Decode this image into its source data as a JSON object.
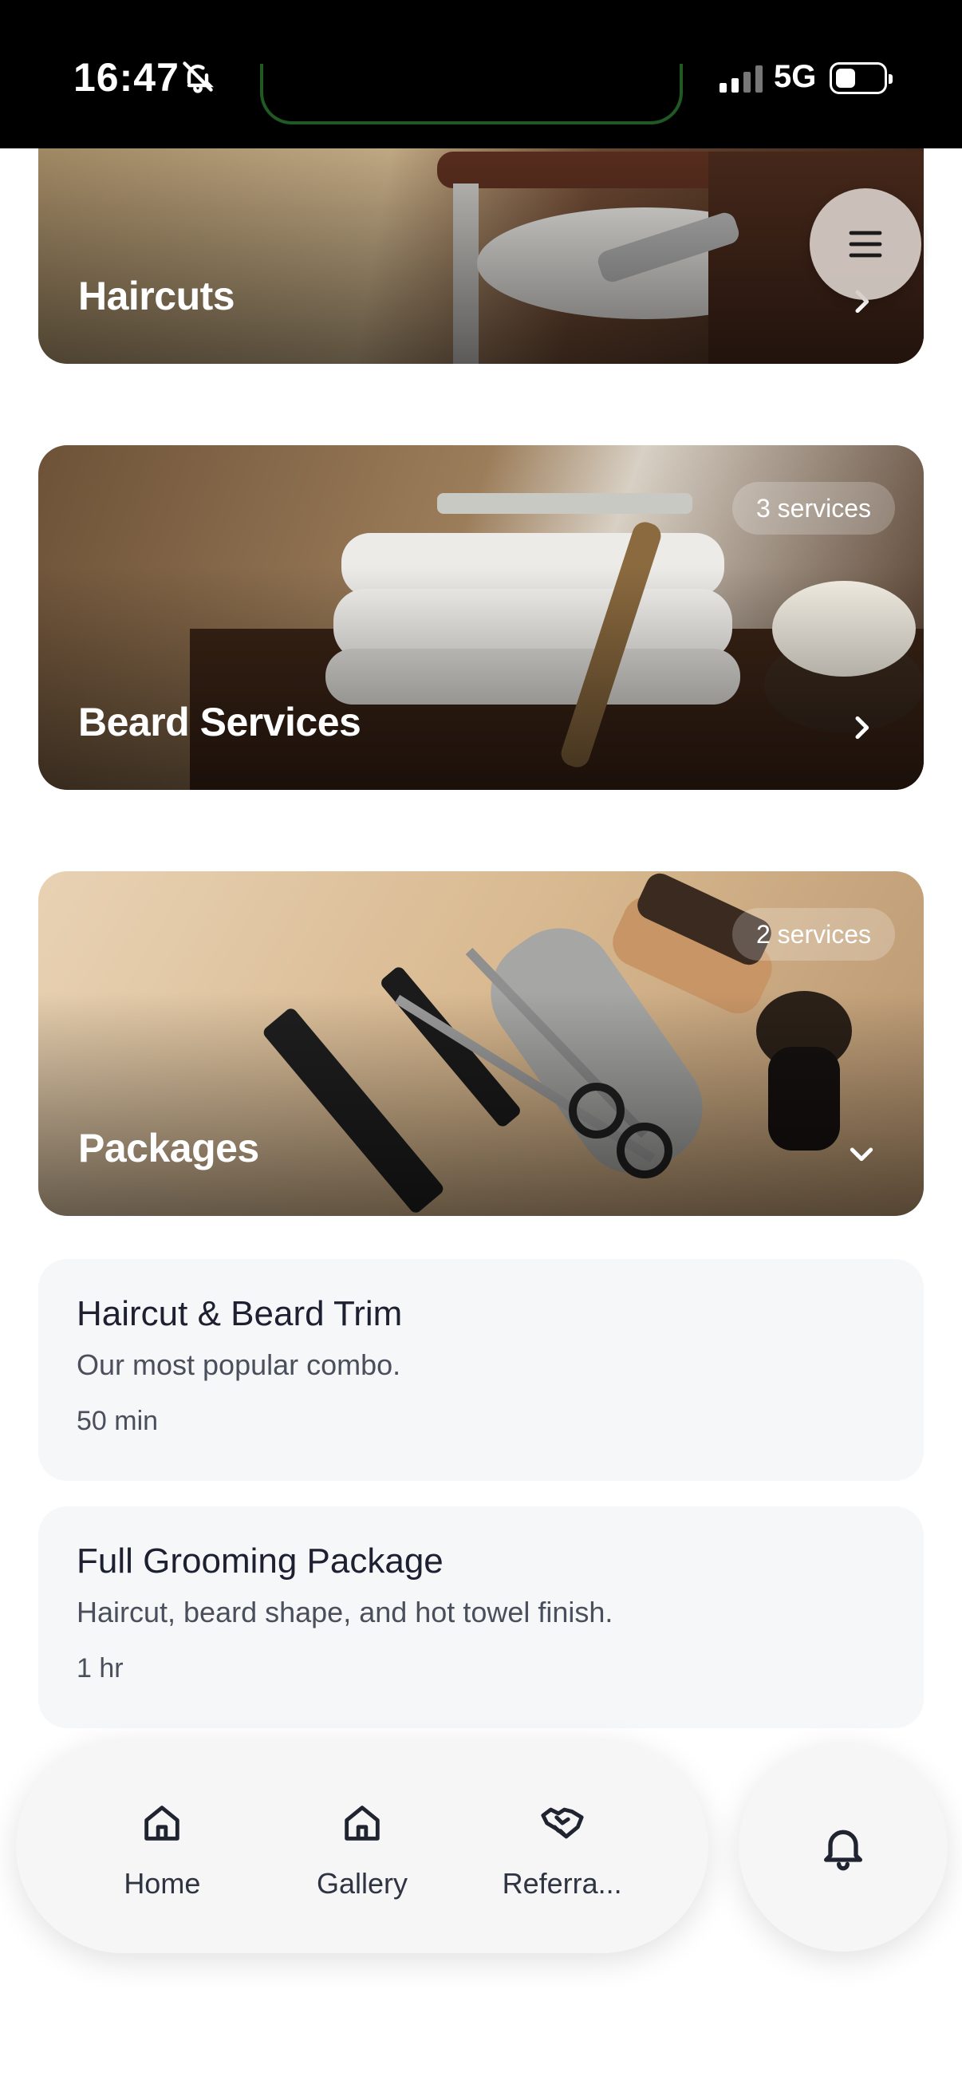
{
  "status_bar": {
    "time": "16:47",
    "network": "5G"
  },
  "categories": [
    {
      "title": "Haircuts",
      "badge": ""
    },
    {
      "title": "Beard Services",
      "badge": "3 services"
    },
    {
      "title": "Packages",
      "badge": "2 services",
      "expanded": true
    }
  ],
  "packages": [
    {
      "name": "Haircut & Beard Trim",
      "description": "Our most popular combo.",
      "duration": "50 min"
    },
    {
      "name": "Full Grooming Package",
      "description": "Haircut, beard shape, and hot towel finish.",
      "duration": "1 hr"
    }
  ],
  "nav": {
    "items": [
      {
        "label": "Home",
        "icon": "home-icon"
      },
      {
        "label": "Gallery",
        "icon": "home-icon"
      },
      {
        "label": "Referra...",
        "icon": "handshake-icon"
      }
    ],
    "notifications_icon": "bell-icon"
  },
  "menu_icon": "hamburger-icon",
  "colors": {
    "status_bar": "#000000",
    "card_text": "#ffffff",
    "list_bg": "#f6f7f9"
  }
}
